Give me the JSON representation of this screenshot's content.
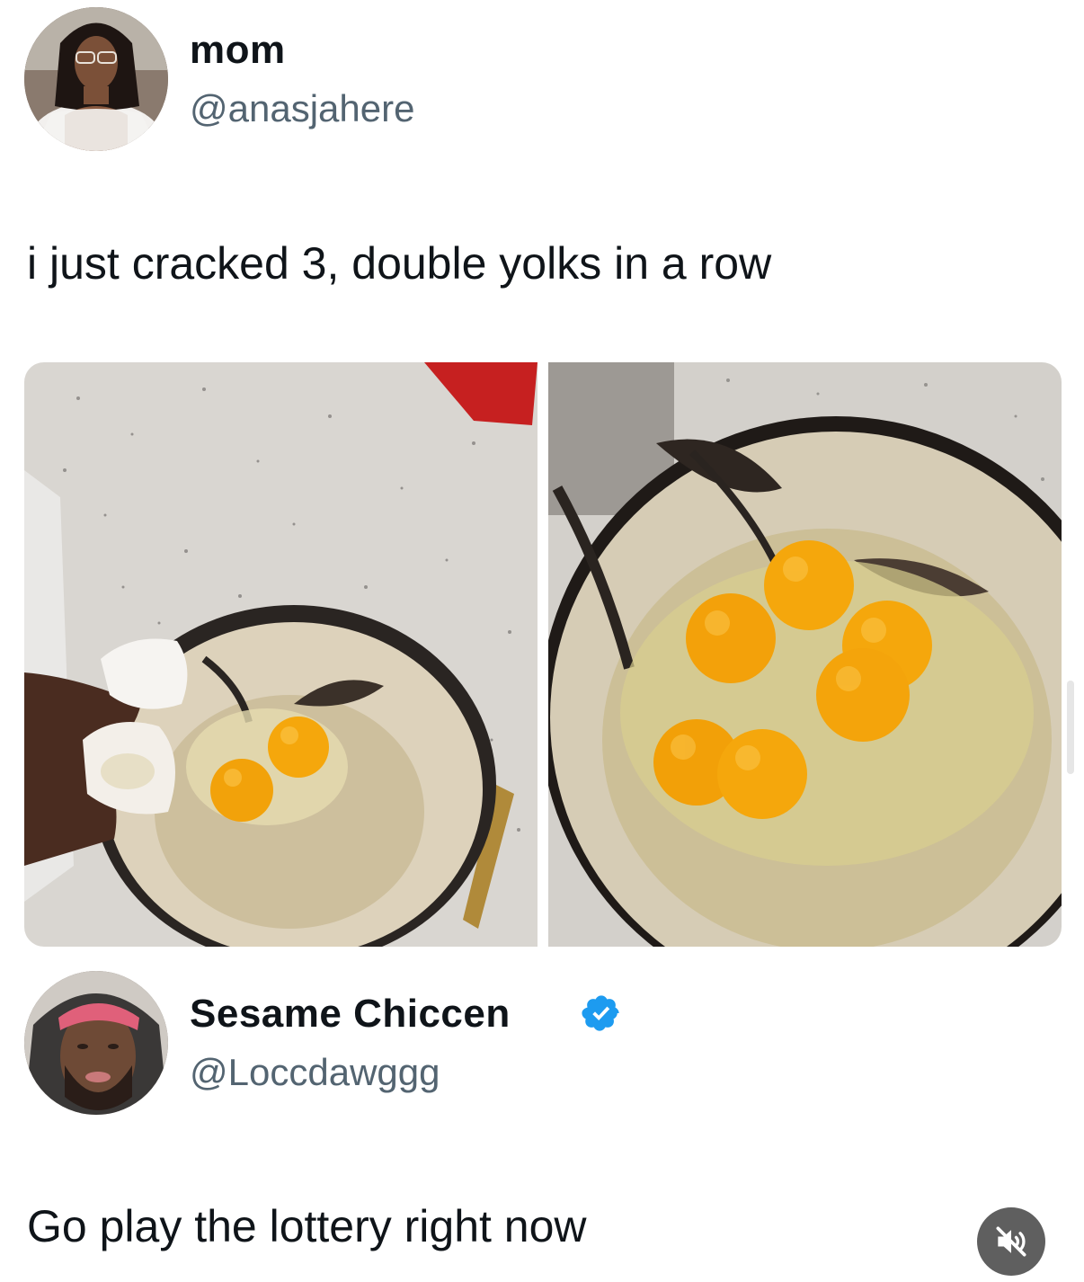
{
  "post": {
    "author": {
      "display_name": "mom",
      "handle": "@anasjahere",
      "avatar_icon": "profile-photo"
    },
    "text": "i just cracked 3, double yolks in a row",
    "media": [
      {
        "icon": "photo-eggs-bowl-on-counter"
      },
      {
        "icon": "photo-double-yolks-closeup"
      }
    ]
  },
  "reply": {
    "author": {
      "display_name": "Sesame Chiccen",
      "handle": "@Loccdawggg",
      "verified": true,
      "avatar_icon": "profile-photo"
    },
    "text": "Go play the lottery right now"
  },
  "controls": {
    "mute_icon": "speaker-muted-icon"
  },
  "colors": {
    "text_primary": "#0f1419",
    "text_secondary": "#536471",
    "verified_blue": "#1d9bf0",
    "yolk": "#f5a70c",
    "mute_button_bg": "#5f5f5f"
  }
}
